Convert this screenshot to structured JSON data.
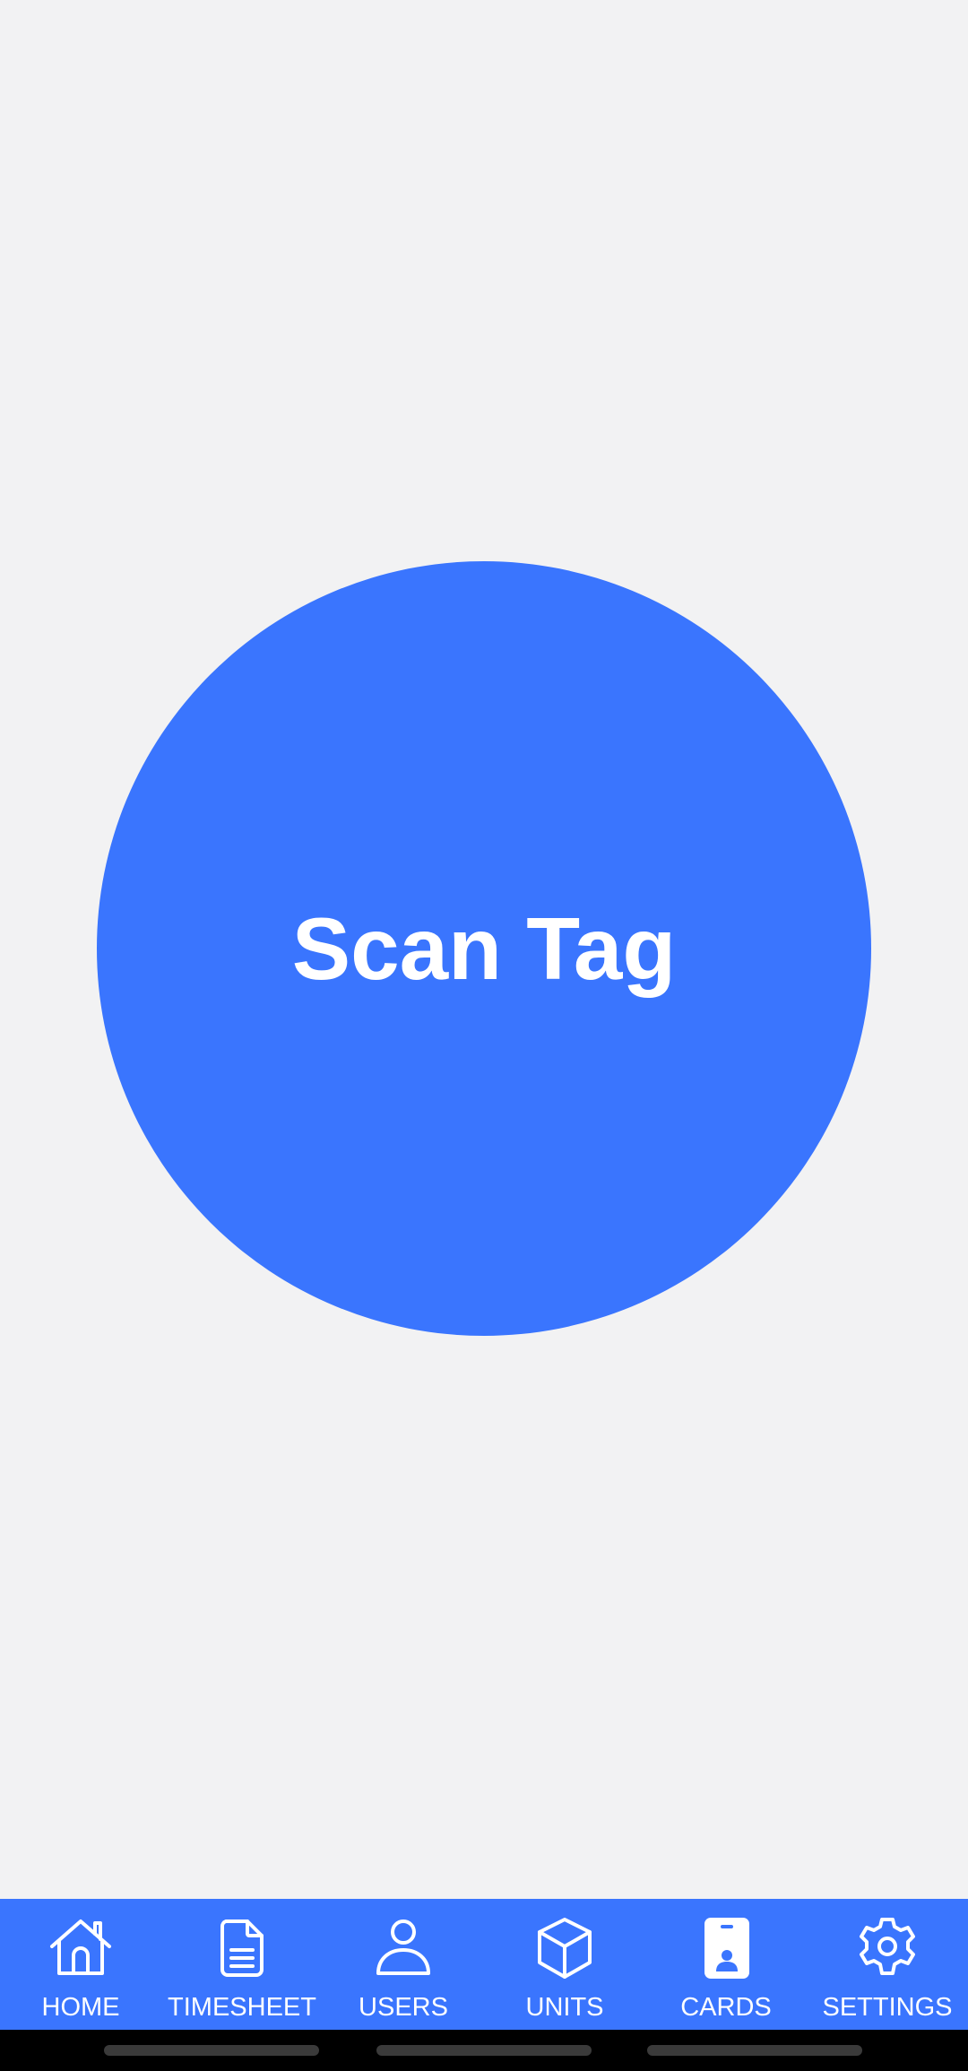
{
  "main": {
    "scan_button_label": "Scan Tag"
  },
  "tabbar": {
    "items": [
      {
        "label": "HOME",
        "icon": "home-icon"
      },
      {
        "label": "TIMESHEET",
        "icon": "document-icon"
      },
      {
        "label": "USERS",
        "icon": "user-icon"
      },
      {
        "label": "UNITS",
        "icon": "cube-icon"
      },
      {
        "label": "CARDS",
        "icon": "id-card-icon",
        "active": true
      },
      {
        "label": "SETTINGS",
        "icon": "gear-icon"
      }
    ]
  },
  "colors": {
    "accent": "#3a75fe",
    "background": "#f2f2f3",
    "text_on_accent": "#ffffff"
  }
}
